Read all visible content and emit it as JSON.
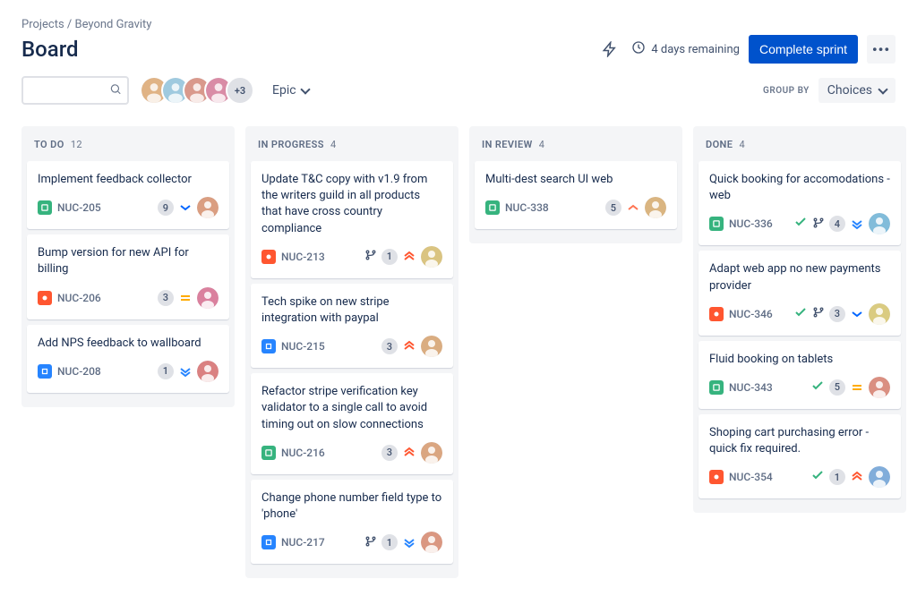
{
  "breadcrumb": "Projects / Beyond Gravity",
  "title": "Board",
  "remaining": "4 days remaining",
  "complete_label": "Complete sprint",
  "epic_label": "Epic",
  "group_by_label": "GROUP BY",
  "group_by_value": "Choices",
  "avatars_more": "+3",
  "columns": [
    {
      "name": "TO DO",
      "count": "12",
      "cards": [
        {
          "title": "Implement feedback collector",
          "type": "story",
          "key": "NUC-205",
          "estimate": "9",
          "priority": "low",
          "avatar_hue": 20,
          "branch": false,
          "done": false
        },
        {
          "title": "Bump version for new API for billing",
          "type": "bug",
          "key": "NUC-206",
          "estimate": "3",
          "priority": "medium",
          "avatar_hue": 340,
          "branch": false,
          "done": false
        },
        {
          "title": "Add NPS feedback to wallboard",
          "type": "task",
          "key": "NUC-208",
          "estimate": "1",
          "priority": "lowest",
          "avatar_hue": 0,
          "branch": false,
          "done": false
        }
      ]
    },
    {
      "name": "IN PROGRESS",
      "count": "4",
      "cards": [
        {
          "title": "Update T&C copy with v1.9 from the writers guild in all products that have cross country compliance",
          "type": "bug",
          "key": "NUC-213",
          "estimate": "1",
          "priority": "highest",
          "avatar_hue": 45,
          "branch": true,
          "done": false
        },
        {
          "title": "Tech spike on new stripe integration with paypal",
          "type": "task",
          "key": "NUC-215",
          "estimate": "3",
          "priority": "highest",
          "avatar_hue": 30,
          "branch": false,
          "done": false
        },
        {
          "title": "Refactor stripe verification key validator to a single call to avoid timing out on slow connections",
          "type": "story",
          "key": "NUC-216",
          "estimate": "3",
          "priority": "highest",
          "avatar_hue": 25,
          "branch": false,
          "done": false
        },
        {
          "title": "Change phone number field type to 'phone'",
          "type": "task",
          "key": "NUC-217",
          "estimate": "1",
          "priority": "lowest",
          "avatar_hue": 15,
          "branch": true,
          "done": false
        }
      ]
    },
    {
      "name": "IN REVIEW",
      "count": "4",
      "cards": [
        {
          "title": "Multi-dest search UI web",
          "type": "story",
          "key": "NUC-338",
          "estimate": "5",
          "priority": "high",
          "avatar_hue": 35,
          "branch": false,
          "done": false
        }
      ]
    },
    {
      "name": "DONE",
      "count": "4",
      "cards": [
        {
          "title": "Quick booking for accomodations - web",
          "type": "story",
          "key": "NUC-336",
          "estimate": "4",
          "priority": "lowest",
          "avatar_hue": 200,
          "branch": true,
          "done": true
        },
        {
          "title": "Adapt web app no new payments provider",
          "type": "bug",
          "key": "NUC-346",
          "estimate": "3",
          "priority": "low",
          "avatar_hue": 50,
          "branch": true,
          "done": true
        },
        {
          "title": "Fluid booking on tablets",
          "type": "story",
          "key": "NUC-343",
          "estimate": "5",
          "priority": "medium",
          "avatar_hue": 10,
          "branch": false,
          "done": true
        },
        {
          "title": "Shoping cart purchasing error - quick fix required.",
          "type": "bug",
          "key": "NUC-354",
          "estimate": "1",
          "priority": "highest",
          "avatar_hue": 210,
          "branch": false,
          "done": true
        }
      ]
    }
  ]
}
